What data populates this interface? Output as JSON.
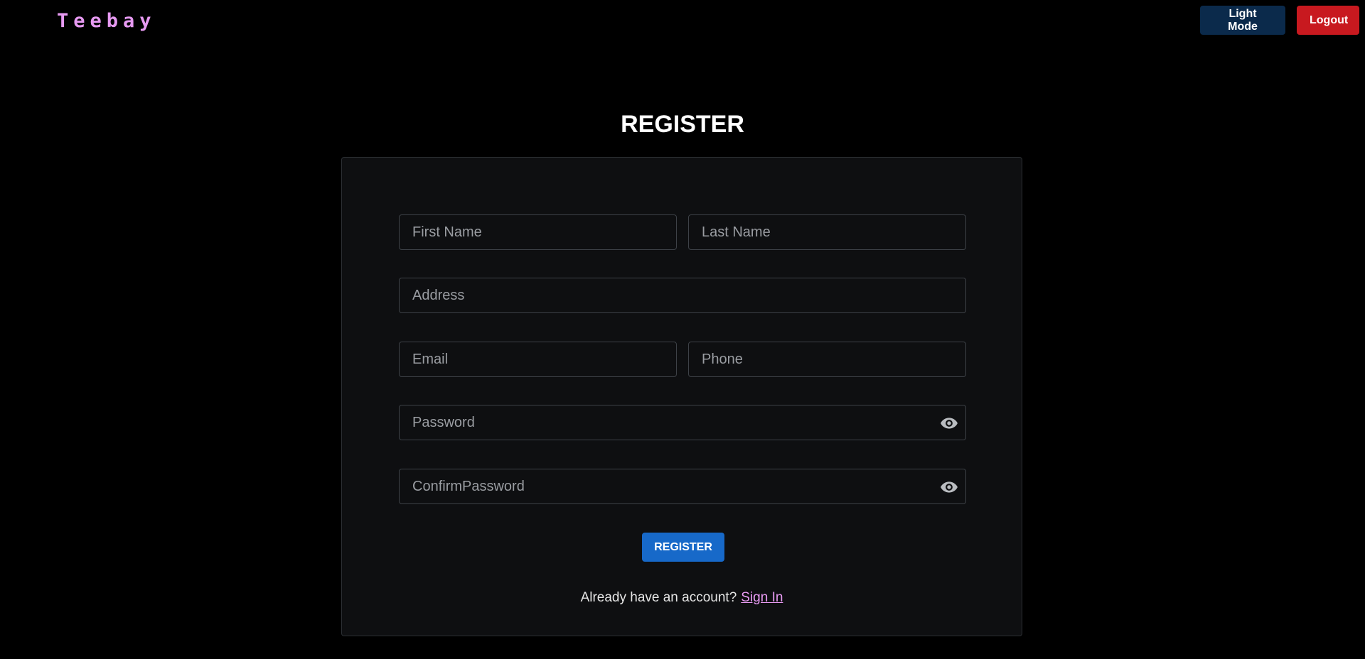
{
  "brand": "Teebay",
  "header": {
    "light_mode_label": "Light Mode",
    "logout_label": "Logout"
  },
  "page_title": "REGISTER",
  "form": {
    "first_name_placeholder": "First Name",
    "last_name_placeholder": "Last Name",
    "address_placeholder": "Address",
    "email_placeholder": "Email",
    "phone_placeholder": "Phone",
    "password_placeholder": "Password",
    "confirm_password_placeholder": "ConfirmPassword",
    "submit_label": "REGISTER",
    "signin_prompt": "Already have an account?",
    "signin_link": "Sign In"
  },
  "colors": {
    "background": "#000000",
    "brand": "#e79af2",
    "light_mode_button": "#0b2a4b",
    "logout_button": "#c8191f",
    "register_button": "#1769c9",
    "card": "#0e0f11"
  },
  "icons": {
    "password_toggle": "eye-icon",
    "confirm_password_toggle": "eye-icon"
  }
}
